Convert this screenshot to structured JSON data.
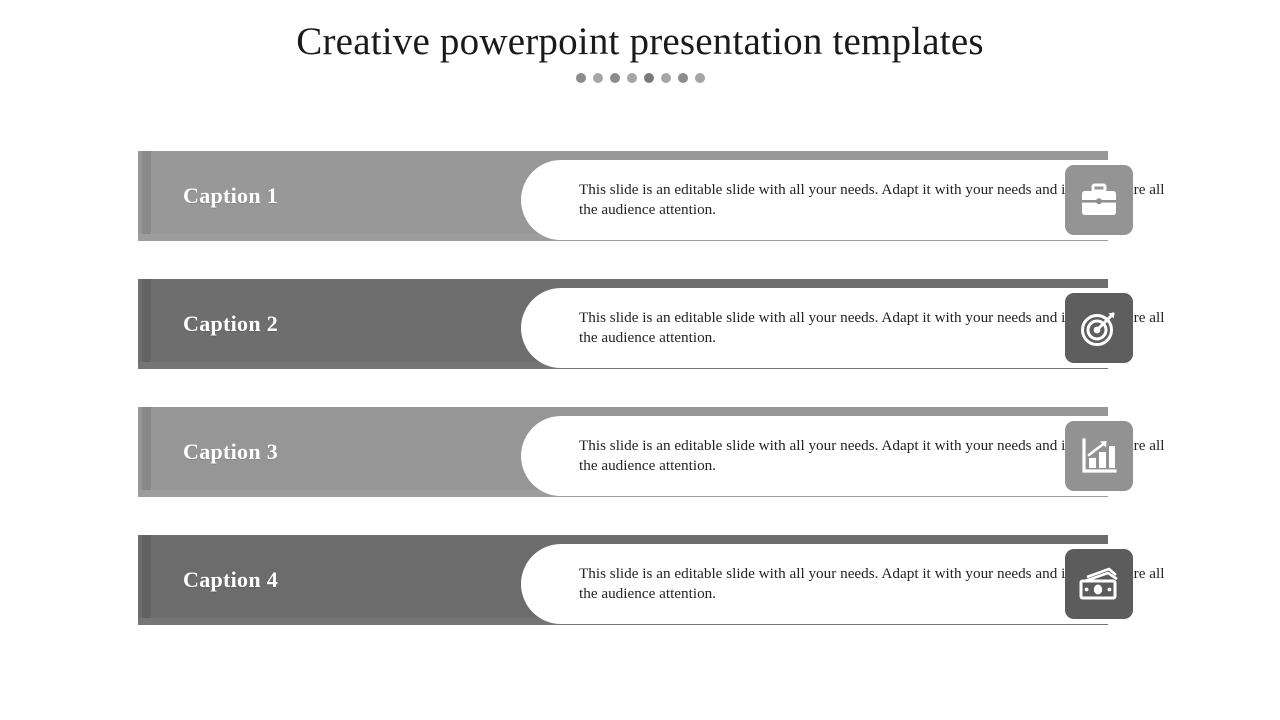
{
  "header": {
    "title": "Creative powerpoint presentation templates",
    "dots": [
      {
        "name": "dot-1",
        "color": "#8c8c8c"
      },
      {
        "name": "dot-2",
        "color": "#a5a5a5"
      },
      {
        "name": "dot-3",
        "color": "#8c8c8c"
      },
      {
        "name": "dot-4",
        "color": "#a5a5a5"
      },
      {
        "name": "dot-5",
        "color": "#7a7a7a"
      },
      {
        "name": "dot-6",
        "color": "#a5a5a5"
      },
      {
        "name": "dot-7",
        "color": "#8c8c8c"
      },
      {
        "name": "dot-8",
        "color": "#a5a5a5"
      }
    ]
  },
  "body_text": "This slide is an editable slide with all your needs. Adapt it with your needs and it will capture all the audience attention.",
  "colors": {
    "bar_light": "#989898",
    "bar_dark": "#6e6e6e",
    "strip_light": "#9d9d9d",
    "strip_dark": "#757575",
    "tile_light": "#949494",
    "tile_dark": "#5e5e5e",
    "pill": "#ffffff",
    "caption_text": "#ffffff",
    "body_text": "#232323",
    "title_text": "#1a1a1a"
  },
  "rows": [
    {
      "caption": "Caption 1",
      "text": "This slide is an editable slide with all your needs. Adapt it with your needs and it will capture all the audience attention.",
      "icon": "briefcase-icon",
      "bar_color": "#989898",
      "strip_color": "#9d9d9d",
      "tile_color": "#949494"
    },
    {
      "caption": "Caption 2",
      "text": "This slide is an editable slide with all your needs. Adapt it with your needs and it will capture all the audience attention.",
      "icon": "target-icon",
      "bar_color": "#6e6e6e",
      "strip_color": "#757575",
      "tile_color": "#5e5e5e"
    },
    {
      "caption": "Caption 3",
      "text": "This slide is an editable slide with all your needs. Adapt it with your needs and it will capture all the audience attention.",
      "icon": "bar-chart-growth-icon",
      "bar_color": "#969696",
      "strip_color": "#9d9d9d",
      "tile_color": "#929292"
    },
    {
      "caption": "Caption 4",
      "text": "This slide is an editable slide with all your needs. Adapt it with your needs and it will capture all the audience attention.",
      "icon": "money-cash-icon",
      "bar_color": "#6c6c6c",
      "strip_color": "#757575",
      "tile_color": "#5c5c5c"
    }
  ]
}
